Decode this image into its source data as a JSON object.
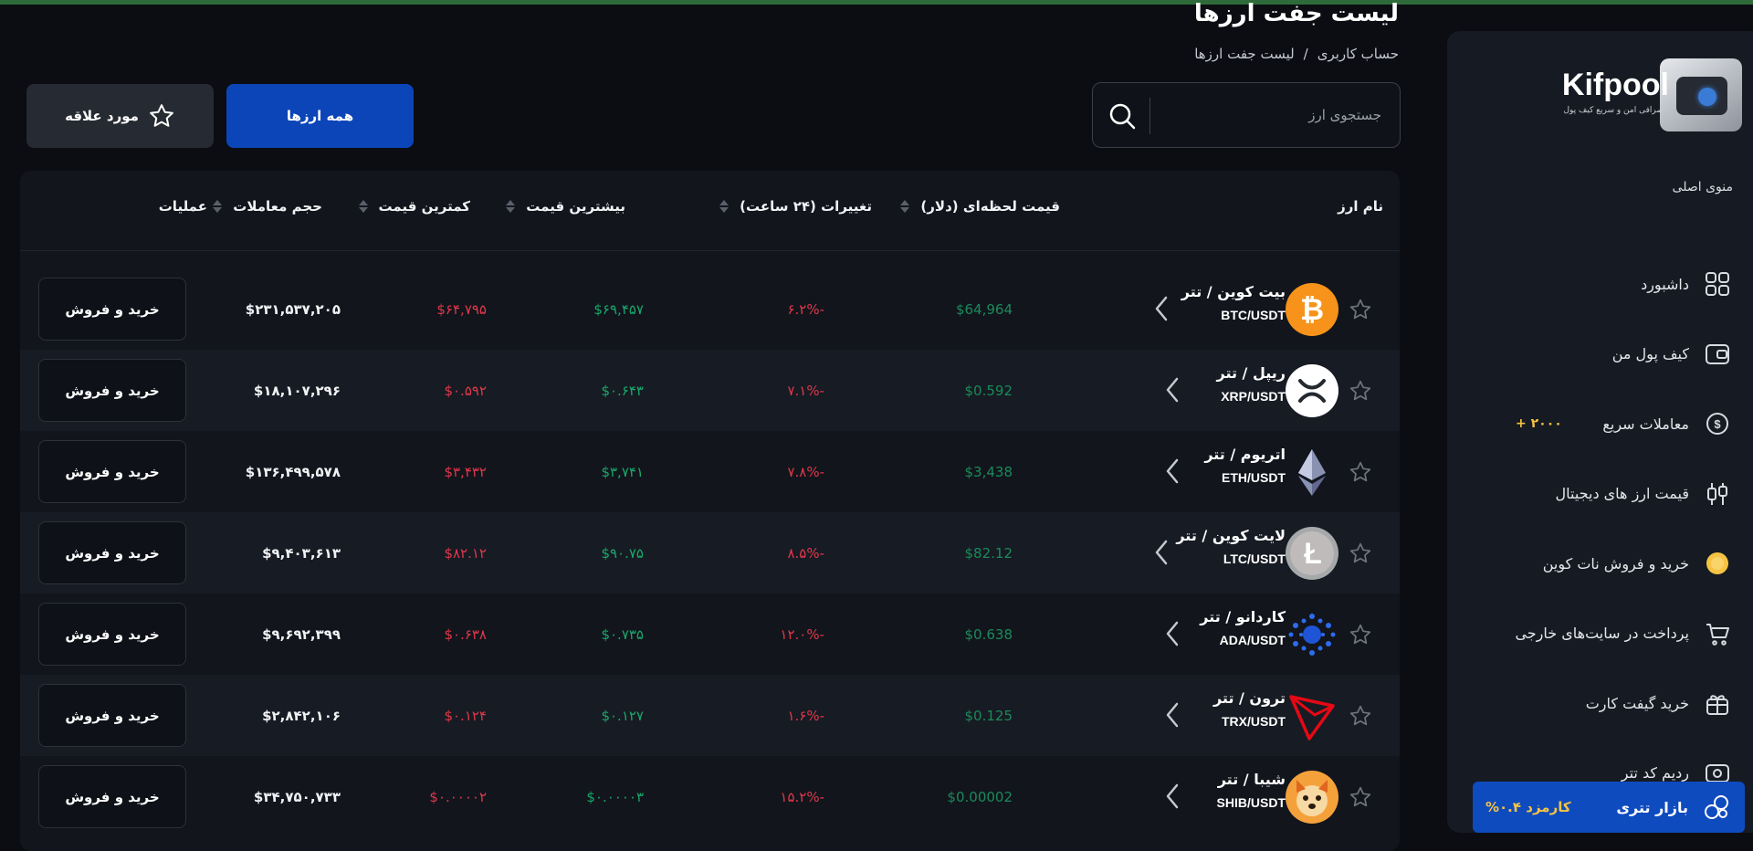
{
  "header": {
    "title": "لیست جفت ارزها",
    "breadcrumb": [
      "حساب کاربری",
      "/",
      "لیست جفت ارزها"
    ]
  },
  "search": {
    "placeholder": "جستجوی ارز"
  },
  "filters": {
    "all_label": "همه ارزها",
    "fav_label": "مورد علاقه"
  },
  "brand": {
    "name": "Kifpool",
    "tagline": "صرافی امن و سریع کیف پول"
  },
  "sidebar": {
    "heading": "منوی اصلی",
    "items": [
      {
        "label": "داشبورد",
        "icon": "dashboard-icon"
      },
      {
        "label": "کیف پول من",
        "icon": "wallet-icon"
      },
      {
        "label": "معاملات سریع",
        "icon": "fast-trade-icon",
        "badge": "+ ۲۰۰۰"
      },
      {
        "label": "قیمت ارز های دیجیتال",
        "icon": "candles-icon"
      },
      {
        "label": "خرید و فروش نات کوین",
        "icon": "notcoin-icon"
      },
      {
        "label": "پرداخت در سایت‌های خارجی",
        "icon": "cart-icon"
      },
      {
        "label": "خرید گیفت کارت",
        "icon": "gift-icon"
      },
      {
        "label": "ردیم کد تتر",
        "icon": "redeem-icon"
      }
    ],
    "tether": {
      "label": "بازار تتری",
      "fee": "کارمزد ۰.۴%"
    }
  },
  "table": {
    "headers": {
      "name": "نام ارز",
      "price": "قیمت لحظه‌ای (دلار)",
      "change": "تغییرات (۲۴ ساعت)",
      "high": "بیشترین قیمت",
      "low": "کمترین قیمت",
      "volume": "حجم معاملات",
      "actions": "عملیات"
    },
    "trade_label": "خرید و فروش",
    "rows": [
      {
        "fa": "بیت کوین / تتر",
        "pair": "BTC/USDT",
        "price": "$64,964",
        "change": "۶.۲%-",
        "high": "$۶۹,۴۵۷",
        "low": "$۶۴,۷۹۵",
        "volume": "$۲۳۱,۵۳۷,۲۰۵",
        "icon": "bitcoin-icon"
      },
      {
        "fa": "ریپل / تتر",
        "pair": "XRP/USDT",
        "price": "$0.592",
        "change": "۷.۱%-",
        "high": "$۰.۶۴۳",
        "low": "$۰.۵۹۲",
        "volume": "$۱۸,۱۰۷,۲۹۶",
        "icon": "xrp-icon"
      },
      {
        "fa": "اتریوم / تتر",
        "pair": "ETH/USDT",
        "price": "$3,438",
        "change": "۷.۸%-",
        "high": "$۳,۷۴۱",
        "low": "$۳,۴۳۲",
        "volume": "$۱۳۶,۴۹۹,۵۷۸",
        "icon": "ethereum-icon"
      },
      {
        "fa": "لایت کوین / تتر",
        "pair": "LTC/USDT",
        "price": "$82.12",
        "change": "۸.۵%-",
        "high": "$۹۰.۷۵",
        "low": "$۸۲.۱۲",
        "volume": "$۹,۴۰۳,۶۱۳",
        "icon": "litecoin-icon"
      },
      {
        "fa": "کاردانو / تتر",
        "pair": "ADA/USDT",
        "price": "$0.638",
        "change": "۱۲.۰%-",
        "high": "$۰.۷۳۵",
        "low": "$۰.۶۳۸",
        "volume": "$۹,۶۹۲,۳۹۹",
        "icon": "cardano-icon"
      },
      {
        "fa": "ترون / تتر",
        "pair": "TRX/USDT",
        "price": "$0.125",
        "change": "۱.۶%-",
        "high": "$۰.۱۲۷",
        "low": "$۰.۱۲۴",
        "volume": "$۲,۸۴۲,۱۰۶",
        "icon": "tron-icon"
      },
      {
        "fa": "شیبا / تتر",
        "pair": "SHIB/USDT",
        "price": "$0.00002",
        "change": "۱۵.۲%-",
        "high": "$۰.۰۰۰۰۳",
        "low": "$۰.۰۰۰۰۲",
        "volume": "$۳۴,۷۵۰,۷۳۳",
        "icon": "shiba-icon"
      }
    ]
  },
  "colors": {
    "accent": "#0c45b8",
    "green": "#19a86a",
    "red": "#e0384b",
    "gold": "#f6c343"
  }
}
